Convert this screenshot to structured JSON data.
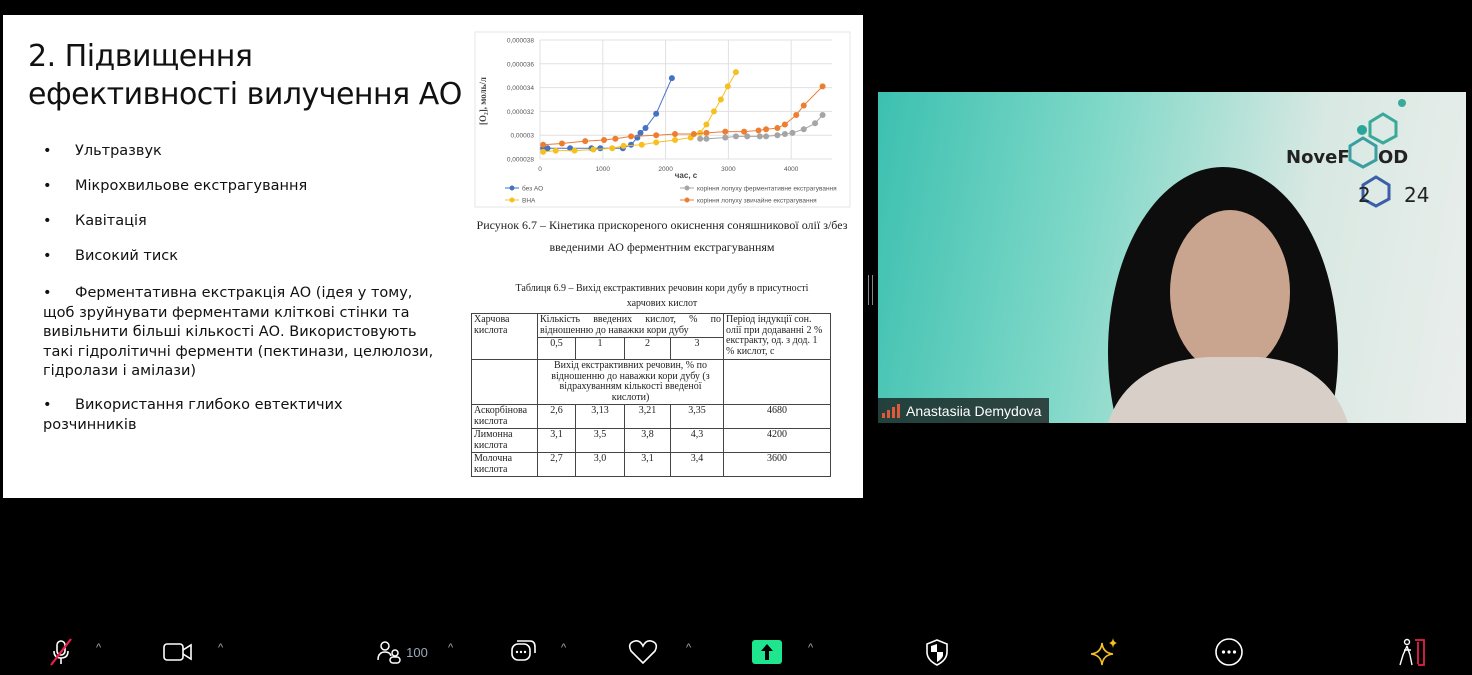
{
  "slide": {
    "title": "2. Підвищення ефективності вилучення АО",
    "bullets": [
      "Ультразвук",
      "Мікрохвильове екстрагування",
      "Кавітація",
      "Високий тиск",
      "Ферментативна екстракція АО (ідея у тому, щоб зруйнувати ферментами кліткові стінки та вивільнити більші кількості АО. Використовують такі гідролітичні ферменти (пектинази, целюлози, гідролази і амілази)",
      "Використання глибоко евтектичих розчинників"
    ],
    "bullet_char": "•",
    "figure_caption_1": "Рисунок 6.7 – Кінетика прискореного окиснення соняшникової олії з/без",
    "figure_caption_2": "введеними АО ферментним екстрагуванням",
    "table": {
      "title_1": "Таблиця 6.9 – Вихід екстрактивних речовин кори дубу в присутності",
      "title_2": "харчових кислот",
      "h_acid": "Харчова кислота",
      "h_amount": "Кількість введених кислот, % по відношенню до наважки кори дубу",
      "h_period": "Період індукції сон. олії при додаванні 2 % екстракту, од. з дод. 1 % кислот, с",
      "h_levels": [
        "0,5",
        "1",
        "2",
        "3"
      ],
      "h_yield": "Вихід екстрактивних речовин, % по відношенню до наважки кори дубу (з відрахуванням кількості введеної кислоти)",
      "rows": [
        {
          "acid": "Аскорбінова кислота",
          "v": [
            "2,6",
            "3,13",
            "3,21",
            "3,35"
          ],
          "period": "4680"
        },
        {
          "acid": "Лимонна кислота",
          "v": [
            "3,1",
            "3,5",
            "3,8",
            "4,3"
          ],
          "period": "4200"
        },
        {
          "acid": "Молочна кислота",
          "v": [
            "2,7",
            "3,0",
            "3,1",
            "3,4"
          ],
          "period": "3600"
        }
      ]
    }
  },
  "chart_data": {
    "type": "line",
    "title": "",
    "xlabel": "час, с",
    "ylabel": "[O₂], моль/л",
    "xlim": [
      0,
      4700
    ],
    "ylim": [
      2.8e-05,
      3.8e-05
    ],
    "xticks": [
      "0",
      "1000",
      "2000",
      "3000",
      "4000"
    ],
    "yticks": [
      "0,000028",
      "0,00003",
      "0,000032",
      "0,000034",
      "0,000036",
      "0,000038"
    ],
    "legend_position": "bottom",
    "series": [
      {
        "name": "без АО",
        "color": "#4472c4",
        "points": [
          [
            50,
            28.9
          ],
          [
            120,
            28.9
          ],
          [
            480,
            28.9
          ],
          [
            820,
            28.9
          ],
          [
            960,
            28.9
          ],
          [
            1320,
            28.9
          ],
          [
            1450,
            29.2
          ],
          [
            1550,
            29.8
          ],
          [
            1600,
            30.2
          ],
          [
            1680,
            30.6
          ],
          [
            1850,
            31.8
          ],
          [
            2100,
            34.8
          ]
        ]
      },
      {
        "name": "BHA",
        "color": "#f5c020",
        "points": [
          [
            50,
            28.6
          ],
          [
            250,
            28.7
          ],
          [
            550,
            28.7
          ],
          [
            850,
            28.8
          ],
          [
            1150,
            28.9
          ],
          [
            1330,
            29.1
          ],
          [
            1620,
            29.2
          ],
          [
            1850,
            29.4
          ],
          [
            2150,
            29.6
          ],
          [
            2400,
            29.8
          ],
          [
            2550,
            30.2
          ],
          [
            2650,
            30.9
          ],
          [
            2770,
            32.0
          ],
          [
            2880,
            33.0
          ],
          [
            2990,
            34.1
          ],
          [
            3120,
            35.3
          ]
        ]
      },
      {
        "name": "коріння лопуху ферментативне екстрагування",
        "color": "#a5a5a5",
        "points": [
          [
            2550,
            29.7
          ],
          [
            2650,
            29.7
          ],
          [
            2950,
            29.8
          ],
          [
            3120,
            29.9
          ],
          [
            3300,
            29.9
          ],
          [
            3500,
            29.9
          ],
          [
            3600,
            29.9
          ],
          [
            3780,
            30.0
          ],
          [
            3900,
            30.1
          ],
          [
            4020,
            30.2
          ],
          [
            4200,
            30.5
          ],
          [
            4380,
            31.0
          ],
          [
            4500,
            31.7
          ]
        ]
      },
      {
        "name": "коріння лопуху звичайне екстрагування",
        "color": "#ed7d31",
        "points": [
          [
            50,
            29.2
          ],
          [
            350,
            29.3
          ],
          [
            720,
            29.5
          ],
          [
            1020,
            29.6
          ],
          [
            1200,
            29.7
          ],
          [
            1450,
            29.9
          ],
          [
            1850,
            30.0
          ],
          [
            2150,
            30.1
          ],
          [
            2450,
            30.1
          ],
          [
            2650,
            30.2
          ],
          [
            2950,
            30.3
          ],
          [
            3250,
            30.3
          ],
          [
            3480,
            30.4
          ],
          [
            3600,
            30.5
          ],
          [
            3780,
            30.6
          ],
          [
            3900,
            30.9
          ],
          [
            4080,
            31.7
          ],
          [
            4200,
            32.5
          ],
          [
            4500,
            34.1
          ]
        ]
      }
    ],
    "y_unit_scale": "1e-6"
  },
  "video": {
    "participant_name": "Anastasiia Demydova",
    "logo_text_1": "NoveF",
    "logo_text_2": "OD",
    "logo_text_3": "2",
    "logo_text_4": "24"
  },
  "toolbar": {
    "participants_count": "100",
    "caret": "^",
    "accent_share": "#1fe58f",
    "leave_color": "#e8204a"
  }
}
